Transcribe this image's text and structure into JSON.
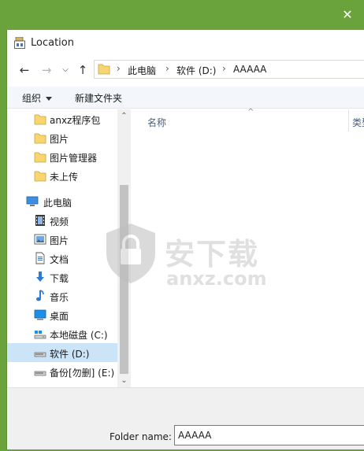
{
  "dialog": {
    "title": "Location"
  },
  "address": {
    "segments": [
      "此电脑",
      "软件 (D:)",
      "AAAAA"
    ]
  },
  "toolbar": {
    "organize_label": "组织",
    "new_folder_label": "新建文件夹"
  },
  "tree": {
    "items": [
      {
        "label": "anxz程序包",
        "icon": "folder-icon"
      },
      {
        "label": "图片",
        "icon": "folder-icon"
      },
      {
        "label": "图片管理器",
        "icon": "folder-icon"
      },
      {
        "label": "未上传",
        "icon": "folder-icon"
      },
      {
        "label": "此电脑",
        "icon": "computer-icon"
      },
      {
        "label": "视频",
        "icon": "video-icon"
      },
      {
        "label": "图片",
        "icon": "pictures-icon"
      },
      {
        "label": "文档",
        "icon": "document-icon"
      },
      {
        "label": "下载",
        "icon": "download-icon"
      },
      {
        "label": "音乐",
        "icon": "music-icon"
      },
      {
        "label": "桌面",
        "icon": "desktop-icon"
      },
      {
        "label": "本地磁盘 (C:)",
        "icon": "drive-icon"
      },
      {
        "label": "软件 (D:)",
        "icon": "drive-icon"
      },
      {
        "label": "备份[勿删] (E:)",
        "icon": "drive-icon"
      }
    ]
  },
  "filelist": {
    "col_name": "名称",
    "col_type": "类型"
  },
  "watermark": {
    "cn": "安下载",
    "en": "anxz.com"
  },
  "bottom": {
    "folder_name_label": "Folder name:",
    "folder_name_value": "AAAAA"
  },
  "colors": {
    "frame_green": "#6aa33c",
    "selection": "#cce4f7",
    "folder_yellow": "#f7d672"
  }
}
